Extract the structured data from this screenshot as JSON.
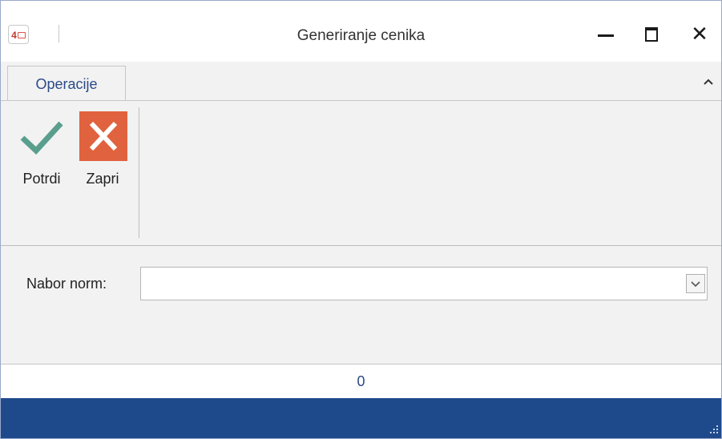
{
  "window": {
    "title": "Generiranje cenika",
    "app_icon_text": "4"
  },
  "ribbon": {
    "tabs": [
      {
        "label": "Operacije"
      }
    ],
    "buttons": [
      {
        "label": "Potrdi",
        "icon": "checkmark-icon",
        "color": "#5a9e8e"
      },
      {
        "label": "Zapri",
        "icon": "close-icon",
        "color": "#e1623e"
      }
    ]
  },
  "form": {
    "nabor_norm_label": "Nabor norm:",
    "nabor_norm_value": ""
  },
  "status": {
    "count": "0"
  },
  "colors": {
    "footer": "#1e4a8c",
    "accent_text": "#2b4a86"
  }
}
